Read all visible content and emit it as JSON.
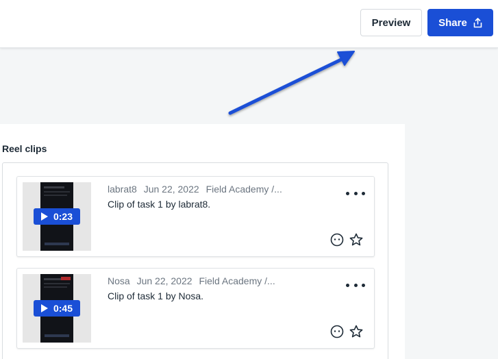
{
  "header": {
    "preview_label": "Preview",
    "share_label": "Share",
    "share_icon": "share-upload-icon"
  },
  "annotation": {
    "arrow_color": "#1a4fd6",
    "arrow_icon": "arrow-pointing-to-preview"
  },
  "reel": {
    "title": "Reel clips",
    "clips": [
      {
        "duration": "0:23",
        "author": "labrat8",
        "date": "Jun 22, 2022",
        "project": "Field Academy /...",
        "description": "Clip of task 1 by labrat8."
      },
      {
        "duration": "0:45",
        "author": "Nosa",
        "date": "Jun 22, 2022",
        "project": "Field Academy /...",
        "description": "Clip of task 1 by Nosa."
      }
    ]
  },
  "colors": {
    "accent": "#1a4fd6",
    "background": "#f4f6f7",
    "text": "#1d2a36",
    "muted": "#6b7580"
  }
}
